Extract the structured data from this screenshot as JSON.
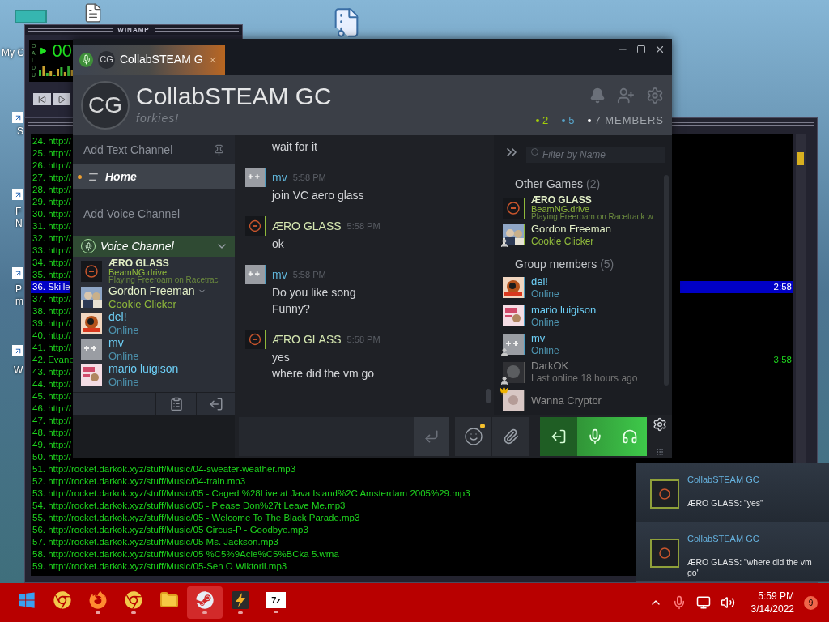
{
  "desktop_icons": [
    {
      "label": [
        "My C"
      ]
    },
    {
      "label": [
        "S"
      ]
    },
    {
      "label": [
        "F",
        "N"
      ]
    },
    {
      "label": [
        "P",
        "m"
      ]
    },
    {
      "label": [
        "W"
      ]
    }
  ],
  "winamp": {
    "title": "WINAMP",
    "indicators": "OAIDU",
    "time": "00"
  },
  "playlist": {
    "rows": [
      {
        "text": "24. http://",
        "selected": false
      },
      {
        "text": "25. http://",
        "selected": false
      },
      {
        "text": "26. http://",
        "selected": false
      },
      {
        "text": "27. http://",
        "selected": false
      },
      {
        "text": "28. http://",
        "selected": false
      },
      {
        "text": "29. http://",
        "selected": false
      },
      {
        "text": "30. http://",
        "selected": false
      },
      {
        "text": "31. http://",
        "selected": false
      },
      {
        "text": "32. http://",
        "selected": false
      },
      {
        "text": "33. http://",
        "selected": false
      },
      {
        "text": "34. http://",
        "selected": false
      },
      {
        "text": "35. http://",
        "selected": false
      },
      {
        "text": "36. Skille",
        "duration": "2:58",
        "selected": true
      },
      {
        "text": "37. http://",
        "selected": false
      },
      {
        "text": "38. http://",
        "selected": false
      },
      {
        "text": "39. http://",
        "selected": false
      },
      {
        "text": "40. http://",
        "selected": false
      },
      {
        "text": "41. http://",
        "selected": false
      },
      {
        "text": "42. Evane",
        "duration": "3:58",
        "selected": false
      },
      {
        "text": "43. http://",
        "selected": false
      },
      {
        "text": "44. http://",
        "selected": false
      },
      {
        "text": "45. http://",
        "selected": false
      },
      {
        "text": "46. http://",
        "selected": false
      },
      {
        "text": "47. http://",
        "selected": false
      },
      {
        "text": "48. http://",
        "selected": false
      },
      {
        "text": "49. http://",
        "selected": false
      },
      {
        "text": "50. http://",
        "selected": false
      },
      {
        "text": "51. http://rocket.darkok.xyz/stuff/Music/04-sweater-weather.mp3",
        "selected": false
      },
      {
        "text": "52. http://rocket.darkok.xyz/stuff/Music/04-train.mp3",
        "selected": false
      },
      {
        "text": "53. http://rocket.darkok.xyz/stuff/Music/05 - Caged %28Live at Java Island%2C Amsterdam 2005%29.mp3",
        "selected": false
      },
      {
        "text": "54. http://rocket.darkok.xyz/stuff/Music/05 - Please Don%27t Leave Me.mp3",
        "selected": false
      },
      {
        "text": "55. http://rocket.darkok.xyz/stuff/Music/05 - Welcome To The Black Parade.mp3",
        "selected": false
      },
      {
        "text": "56. http://rocket.darkok.xyz/stuff/Music/05 Circus-P - Goodbye.mp3",
        "selected": false
      },
      {
        "text": "57. http://rocket.darkok.xyz/stuff/Music/05 Ms. Jackson.mp3",
        "selected": false
      },
      {
        "text": "58. http://rocket.darkok.xyz/stuff/Music/05 %C5%9Acie%C5%BCka 5.wma",
        "selected": false
      },
      {
        "text": "59. http://rocket.darkok.xyz/stuff/Music/05-Sen O Wiktorii.mp3",
        "selected": false
      }
    ]
  },
  "chat_window": {
    "tab": {
      "initials": "CG",
      "title": "CollabSTEAM G",
      "voice_active": true
    },
    "group": {
      "initials": "CG",
      "name": "CollabSTEAM GC",
      "tagline": "forkies!",
      "counts": [
        {
          "text": "2",
          "kind": "ingame"
        },
        {
          "text": "5",
          "kind": "online"
        },
        {
          "text": "7 MEMBERS",
          "kind": "total"
        }
      ]
    },
    "channels": [
      {
        "label": "Add Text Channel",
        "kind": "add-text",
        "selected": false,
        "unread": false
      },
      {
        "label": "Home",
        "kind": "text",
        "selected": true,
        "unread": true
      },
      {
        "label": "Add Voice Channel",
        "kind": "add-voice",
        "selected": false,
        "unread": false
      }
    ],
    "voice_channel": {
      "name": "Voice Channel",
      "expanded": true,
      "members": [
        {
          "name": "ÆRO GLASS",
          "kind": "ingame",
          "game": "BeamNG.drive",
          "detail": "Playing Freeroam on Racetrac",
          "avatar": {
            "kind": "ring"
          },
          "menu": false
        },
        {
          "name": "Gordon Freeman",
          "kind": "ingame",
          "game": "Cookie Clicker",
          "avatar": {
            "kind": "photo"
          },
          "menu": true
        },
        {
          "name": "del!",
          "kind": "online",
          "status": "Online",
          "avatar": {
            "kind": "art"
          },
          "menu": false
        },
        {
          "name": "mv",
          "kind": "online",
          "status": "Online",
          "avatar": {
            "kind": "plus"
          },
          "menu": false
        },
        {
          "name": "mario luigison",
          "kind": "online",
          "status": "Online",
          "avatar": {
            "kind": "poster"
          },
          "menu": false
        }
      ]
    },
    "messages": [
      {
        "lines": [
          "wait for it"
        ]
      },
      {
        "author": "mv",
        "kind": "online",
        "time": "5:58 PM",
        "avatar": {
          "kind": "plus"
        },
        "lines": [
          "join VC aero glass"
        ]
      },
      {
        "author": "ÆRO GLASS",
        "kind": "ingame",
        "time": "5:58 PM",
        "avatar": {
          "kind": "ring"
        },
        "lines": [
          "ok"
        ]
      },
      {
        "author": "mv",
        "kind": "online",
        "time": "5:58 PM",
        "avatar": {
          "kind": "plus"
        },
        "lines": [
          "Do you like song",
          "Funny?"
        ]
      },
      {
        "author": "ÆRO GLASS",
        "kind": "ingame",
        "time": "5:58 PM",
        "avatar": {
          "kind": "ring"
        },
        "lines": [
          "yes",
          "where did the vm go"
        ]
      }
    ],
    "composer": {
      "emoji_new": true,
      "voice_connected": true
    },
    "member_list": {
      "filter_placeholder": "Filter by Name",
      "sections": [
        {
          "title": "Other Games",
          "count": "(2)",
          "members": [
            {
              "name": "ÆRO GLASS",
              "kind": "ingame",
              "game": "BeamNG.drive",
              "detail": "Playing Freeroam on Racetrack w",
              "avatar": {
                "kind": "ring"
              },
              "friend": false,
              "owner": false
            },
            {
              "name": "Gordon Freeman",
              "kind": "ingame",
              "game": "Cookie Clicker",
              "avatar": {
                "kind": "photo"
              },
              "friend": true,
              "owner": false
            }
          ]
        },
        {
          "title": "Group members",
          "count": "(5)",
          "members": [
            {
              "name": "del!",
              "kind": "online",
              "status": "Online",
              "avatar": {
                "kind": "art"
              },
              "friend": false,
              "owner": false
            },
            {
              "name": "mario luigison",
              "kind": "online",
              "status": "Online",
              "avatar": {
                "kind": "poster"
              },
              "friend": false,
              "owner": false
            },
            {
              "name": "mv",
              "kind": "online",
              "status": "Online",
              "avatar": {
                "kind": "plus"
              },
              "friend": true,
              "owner": false
            },
            {
              "name": "DarkOK",
              "kind": "offline",
              "status": "Last online 18 hours ago",
              "avatar": {
                "kind": "dark"
              },
              "friend": true,
              "owner": false
            },
            {
              "name": "Wanna Cryptor",
              "kind": "offline",
              "avatar": {
                "kind": "pale"
              },
              "friend": false,
              "owner": true
            }
          ]
        }
      ]
    }
  },
  "notifications": [
    {
      "title": "CollabSTEAM GC",
      "text": "ÆRO GLASS: \"yes\""
    },
    {
      "title": "CollabSTEAM GC",
      "text": "ÆRO GLASS: \"where did the vm go\""
    }
  ],
  "taskbar": {
    "apps": [
      {
        "kind": "start",
        "running": false,
        "selected": false
      },
      {
        "kind": "chrome",
        "running": false,
        "selected": false
      },
      {
        "kind": "firefox",
        "running": true,
        "selected": false
      },
      {
        "kind": "chrome",
        "running": true,
        "selected": false
      },
      {
        "kind": "folder",
        "running": false,
        "selected": false
      },
      {
        "kind": "steam",
        "running": true,
        "selected": true
      },
      {
        "kind": "winamp",
        "running": true,
        "selected": false
      },
      {
        "kind": "archive",
        "label": "7z",
        "running": true,
        "selected": false
      }
    ],
    "time": "5:59 PM",
    "date": "3/14/2022",
    "badge": "9"
  }
}
